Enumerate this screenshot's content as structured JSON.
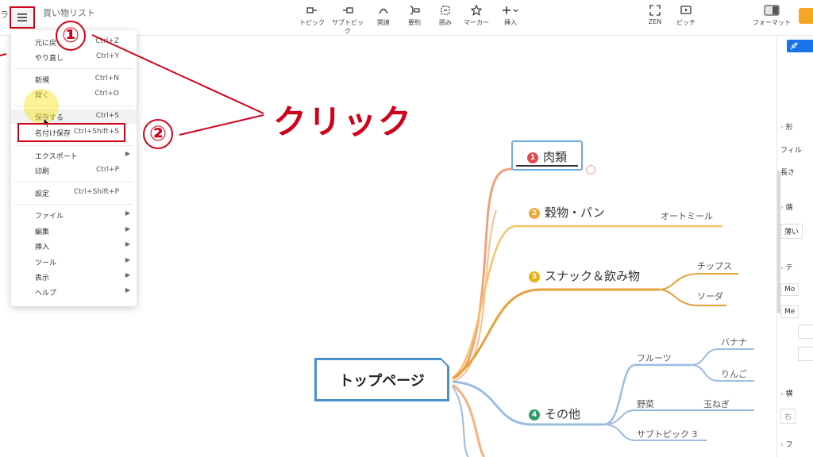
{
  "app": {
    "title": "買い物リスト",
    "logo_letter": "ラ"
  },
  "toolbar": {
    "items": [
      {
        "label": "トピック",
        "icon": "topic-icon"
      },
      {
        "label": "サブトピック",
        "icon": "subtopic-icon"
      },
      {
        "label": "関連",
        "icon": "relation-icon"
      },
      {
        "label": "要約",
        "icon": "summary-icon"
      },
      {
        "label": "囲み",
        "icon": "boundary-icon"
      },
      {
        "label": "マーカー",
        "icon": "marker-star-icon"
      },
      {
        "label": "挿入",
        "icon": "insert-plus-icon"
      }
    ],
    "right": [
      {
        "label": "ZEN",
        "icon": "zen-icon"
      },
      {
        "label": "ピッチ",
        "icon": "pitch-icon"
      },
      {
        "label": "フォーマット",
        "icon": "format-icon"
      }
    ]
  },
  "menu": {
    "items": [
      {
        "label": "元に戻す",
        "shortcut": "Ctrl+Z"
      },
      {
        "label": "やり直し",
        "shortcut": "Ctrl+Y"
      },
      {
        "label": "新規",
        "shortcut": "Ctrl+N"
      },
      {
        "label": "開く",
        "shortcut": "Ctrl+O"
      },
      {
        "label": "保存する",
        "shortcut": "Ctrl+S"
      },
      {
        "label": "名付け保存",
        "shortcut": "Ctrl+Shift+S"
      },
      {
        "label": "エクスポート",
        "shortcut": ""
      },
      {
        "label": "印刷",
        "shortcut": "Ctrl+P"
      },
      {
        "label": "設定",
        "shortcut": "Ctrl+Shift+P"
      },
      {
        "label": "ファイル",
        "shortcut": ""
      },
      {
        "label": "編集",
        "shortcut": ""
      },
      {
        "label": "挿入",
        "shortcut": ""
      },
      {
        "label": "ツール",
        "shortcut": ""
      },
      {
        "label": "表示",
        "shortcut": ""
      },
      {
        "label": "ヘルプ",
        "shortcut": ""
      }
    ]
  },
  "annotations": {
    "step1": "①",
    "step2": "②",
    "click_label": "クリック",
    "accent_color": "#d0021b"
  },
  "mindmap": {
    "central": "トップページ",
    "topics": [
      {
        "num": "1",
        "label": "肉類",
        "color": "#e24b4b"
      },
      {
        "num": "2",
        "label": "穀物・パン",
        "color": "#f0a93a"
      },
      {
        "num": "3",
        "label": "スナック＆飲み物",
        "color": "#e8a317"
      },
      {
        "num": "4",
        "label": "その他",
        "color": "#2e9e6b"
      }
    ],
    "subtopics": {
      "grain": "オートミール",
      "snack_1": "チップス",
      "snack_2": "ソーダ",
      "fruit": "フルーツ",
      "banana": "バナナ",
      "apple": "りんご",
      "veg": "野菜",
      "onion": "玉ねぎ",
      "sub3": "サブトピック 3"
    }
  },
  "right_panel": {
    "rows": [
      "形",
      "フィル",
      "長さ",
      "端",
      "薄い",
      "テ",
      "Mo",
      "Me",
      "横",
      "右",
      "フ"
    ]
  }
}
